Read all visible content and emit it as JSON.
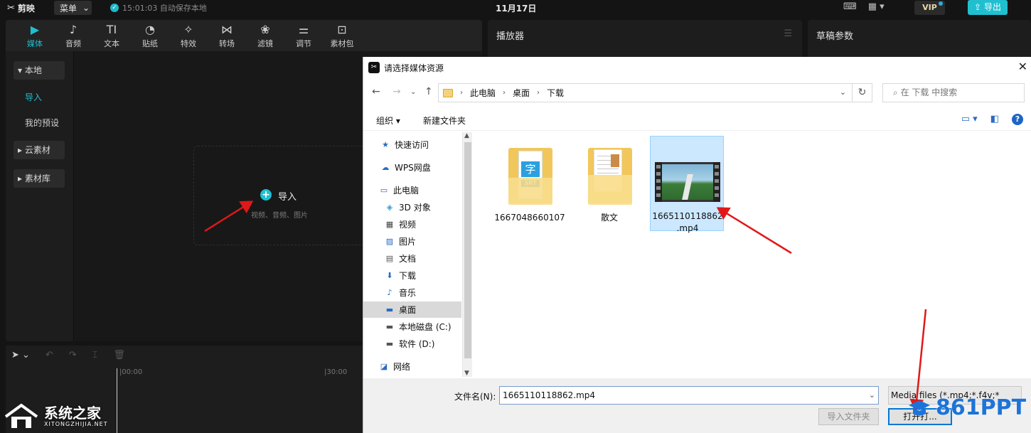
{
  "app": {
    "logo": "剪映",
    "menu_label": "菜单",
    "autosave_text": "15:01:03 自动保存本地",
    "date": "11月17日",
    "vip_label": "VIP",
    "export_label": "导出"
  },
  "toolbar": {
    "tools": [
      {
        "label": "媒体",
        "icon": "▶"
      },
      {
        "label": "音频",
        "icon": "♪"
      },
      {
        "label": "文本",
        "icon": "TI"
      },
      {
        "label": "贴纸",
        "icon": "◔"
      },
      {
        "label": "特效",
        "icon": "✧"
      },
      {
        "label": "转场",
        "icon": "⋈"
      },
      {
        "label": "滤镜",
        "icon": "❀"
      },
      {
        "label": "调节",
        "icon": "⚌"
      },
      {
        "label": "素材包",
        "icon": "⊡"
      }
    ]
  },
  "sidenav": {
    "local": "▾ 本地",
    "import": "导入",
    "presets": "我的预设",
    "cloud": "▸ 云素材",
    "library": "▸ 素材库"
  },
  "media_area": {
    "import_label": "导入",
    "import_hint": "视频、音频、图片"
  },
  "player": {
    "title": "播放器"
  },
  "draft": {
    "title": "草稿参数"
  },
  "timeline": {
    "ruler_start": "|00:00",
    "ruler_mid": "|30:00"
  },
  "dialog": {
    "title": "请选择媒体资源",
    "breadcrumb": [
      "此电脑",
      "桌面",
      "下载"
    ],
    "search_placeholder": "在 下载 中搜索",
    "organize": "组织 ▾",
    "new_folder": "新建文件夹",
    "nav_items": [
      {
        "label": "快速访问",
        "icon": "★",
        "color": "#2a6bc2"
      },
      {
        "label": "WPS网盘",
        "icon": "☁",
        "color": "#2a6bc2"
      },
      {
        "label": "此电脑",
        "icon": "▭",
        "color": "#2a6bc2"
      },
      {
        "label": "3D 对象",
        "icon": "◈",
        "color": "#2aa0e0"
      },
      {
        "label": "视频",
        "icon": "▦",
        "color": "#444"
      },
      {
        "label": "图片",
        "icon": "▨",
        "color": "#2a6bc2"
      },
      {
        "label": "文档",
        "icon": "▤",
        "color": "#555"
      },
      {
        "label": "下载",
        "icon": "⬇",
        "color": "#2a6bc2"
      },
      {
        "label": "音乐",
        "icon": "♪",
        "color": "#2a6bc2"
      },
      {
        "label": "桌面",
        "icon": "▬",
        "color": "#2a6bc2"
      },
      {
        "label": "本地磁盘 (C:)",
        "icon": "▬",
        "color": "#555"
      },
      {
        "label": "软件 (D:)",
        "icon": "▬",
        "color": "#555"
      },
      {
        "label": "网络",
        "icon": "◪",
        "color": "#2a6bc2"
      }
    ],
    "files": [
      {
        "name": "1667048660107"
      },
      {
        "name": "散文"
      },
      {
        "name": "1665110118862\n.mp4"
      }
    ],
    "filename_label": "文件名(N):",
    "filename_value": "1665110118862.mp4",
    "filetype_value": "Media files (*.mp4;*.f4v;*",
    "btn_import_folder": "导入文件夹",
    "btn_open": "打开打..."
  },
  "watermarks": {
    "left_main": "系统之家",
    "left_sub": "XITONGZHIJIA.NET",
    "right": "861PPT"
  },
  "colors": {
    "accent": "#1fbfd0",
    "annotation_arrow": "#e01818",
    "dialog_focus": "#0078d7",
    "file_selected_bg": "#cce8ff"
  }
}
